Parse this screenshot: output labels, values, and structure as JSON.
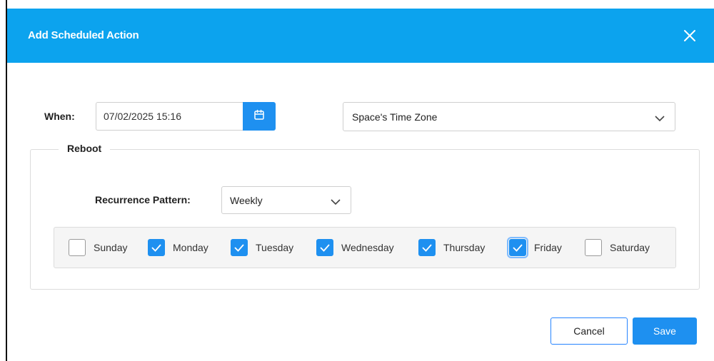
{
  "dialog": {
    "title": "Add Scheduled Action",
    "close_icon": "close-icon"
  },
  "when": {
    "label": "When:",
    "date_value": "07/02/2025 15:16",
    "calendar_icon": "calendar-icon",
    "timezone_value": "Space's Time Zone"
  },
  "reboot": {
    "legend": "Reboot",
    "recurrence_label": "Recurrence Pattern:",
    "recurrence_value": "Weekly",
    "days": [
      {
        "label": "Sunday",
        "checked": false
      },
      {
        "label": "Monday",
        "checked": true
      },
      {
        "label": "Tuesday",
        "checked": true
      },
      {
        "label": "Wednesday",
        "checked": true
      },
      {
        "label": "Thursday",
        "checked": true
      },
      {
        "label": "Friday",
        "checked": true
      },
      {
        "label": "Saturday",
        "checked": false
      }
    ]
  },
  "footer": {
    "cancel_label": "Cancel",
    "save_label": "Save"
  },
  "colors": {
    "header": "#0ca3ee",
    "primary": "#1e90f0"
  }
}
